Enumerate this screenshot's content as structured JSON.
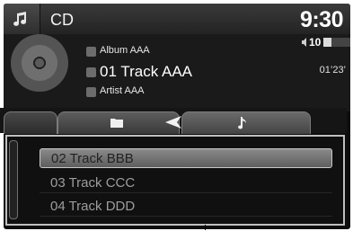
{
  "header": {
    "source_title": "CD",
    "clock": "9:30",
    "music_icon": "music-note-icon"
  },
  "now_playing": {
    "album": "Album AAA",
    "track": "01 Track AAA",
    "artist": "Artist AAA",
    "elapsed": "01’23’",
    "volume_level": "10",
    "volume_fraction": 0.3
  },
  "tabs": [
    {
      "icon": "folder-icon"
    },
    {
      "icon": "back-arrow-icon"
    },
    {
      "icon": "music-note-icon"
    }
  ],
  "track_list": {
    "items": [
      "02 Track BBB",
      "03 Track CCC",
      "04 Track DDD"
    ],
    "selected_index": 0
  }
}
